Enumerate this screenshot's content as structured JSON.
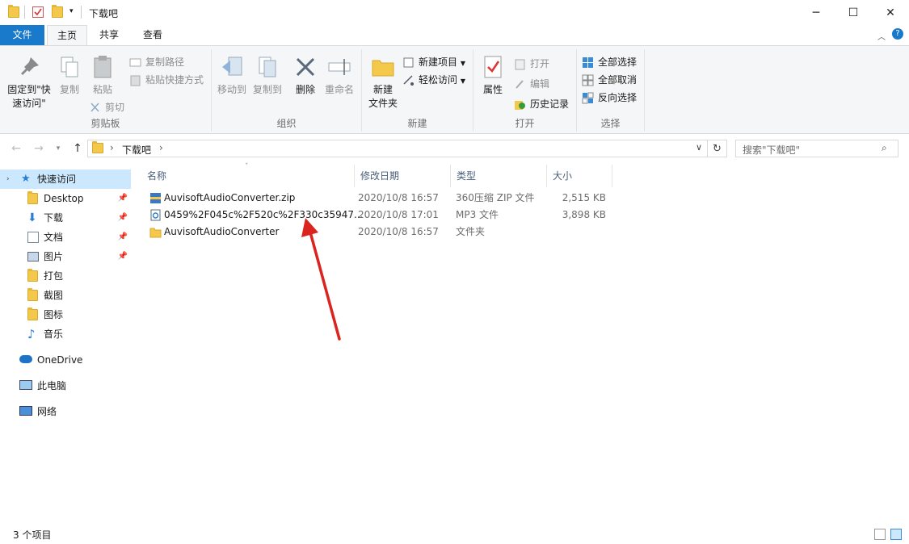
{
  "window": {
    "title": "下载吧",
    "minimize_glyph": "─",
    "maximize_glyph": "☐",
    "close_glyph": "✕"
  },
  "tabs": [
    {
      "label": "文件"
    },
    {
      "label": "主页"
    },
    {
      "label": "共享"
    },
    {
      "label": "查看"
    }
  ],
  "ribbon": {
    "clipboard": {
      "group": "剪贴板",
      "pin_line1": "固定到\"快",
      "pin_line2": "速访问\"",
      "copy": "复制",
      "paste": "粘贴",
      "copy_path": "复制路径",
      "paste_shortcut": "粘贴快捷方式",
      "cut": "剪切"
    },
    "organize": {
      "group": "组织",
      "move_to": "移动到",
      "copy_to": "复制到",
      "delete": "删除",
      "rename": "重命名"
    },
    "new": {
      "group": "新建",
      "new_folder_line1": "新建",
      "new_folder_line2": "文件夹",
      "new_item": "新建项目",
      "easy_access": "轻松访问"
    },
    "open": {
      "group": "打开",
      "properties": "属性",
      "open": "打开",
      "edit": "编辑",
      "history": "历史记录"
    },
    "select": {
      "group": "选择",
      "select_all": "全部选择",
      "select_none": "全部取消",
      "invert": "反向选择"
    }
  },
  "address": {
    "path": "下载吧",
    "search_placeholder": "搜索\"下载吧\""
  },
  "nav": {
    "quick_access": "快速访问",
    "items": [
      {
        "label": "Desktop",
        "pinned": true
      },
      {
        "label": "下载",
        "pinned": true
      },
      {
        "label": "文档",
        "pinned": true
      },
      {
        "label": "图片",
        "pinned": true
      },
      {
        "label": "打包",
        "pinned": false
      },
      {
        "label": "截图",
        "pinned": false
      },
      {
        "label": "图标",
        "pinned": false
      },
      {
        "label": "音乐",
        "pinned": false
      }
    ],
    "onedrive": "OneDrive",
    "this_pc": "此电脑",
    "network": "网络"
  },
  "columns": {
    "name": "名称",
    "modified": "修改日期",
    "type": "类型",
    "size": "大小"
  },
  "files": [
    {
      "name": "AuvisoftAudioConverter.zip",
      "date": "2020/10/8 16:57",
      "type": "360压缩 ZIP 文件",
      "size": "2,515 KB",
      "icon": "zip-icon"
    },
    {
      "name": "0459%2F045c%2F520c%2F330c35947...",
      "date": "2020/10/8 17:01",
      "type": "MP3 文件",
      "size": "3,898 KB",
      "icon": "audio-file-icon"
    },
    {
      "name": "AuvisoftAudioConverter",
      "date": "2020/10/8 16:57",
      "type": "文件夹",
      "size": "",
      "icon": "folder-icon"
    }
  ],
  "status": {
    "count": "3 个项目"
  },
  "colors": {
    "accent": "#1979ca",
    "folder": "#f3c84b",
    "annotation_arrow": "#d9241f"
  }
}
